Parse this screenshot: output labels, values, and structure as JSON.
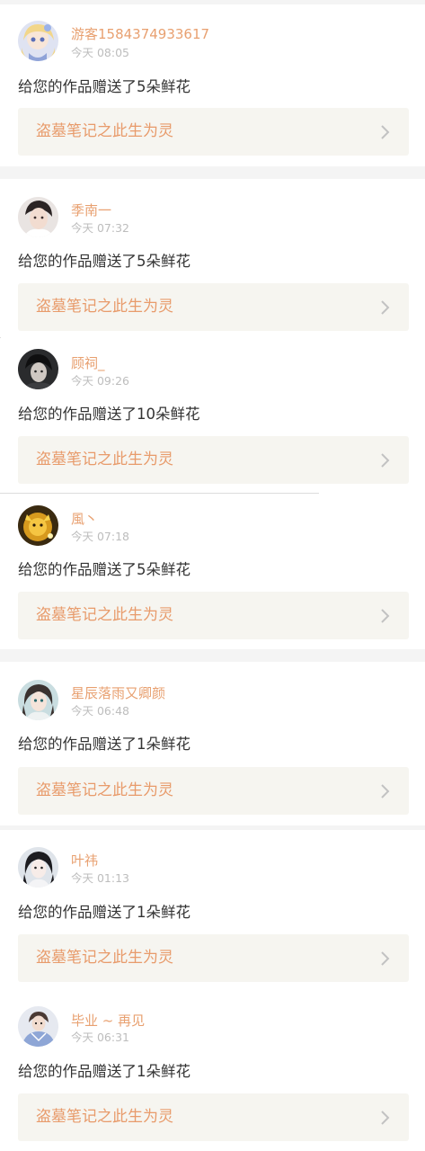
{
  "feed": [
    {
      "username": "游客1584374933617",
      "time": "今天 08:05",
      "message": "给您的作品赠送了5朵鲜花",
      "work_title": "盗墓笔记之此生为灵",
      "avatar": "anime-girl-avatar"
    },
    {
      "username": "季南一",
      "time": "今天 07:32",
      "message": "给您的作品赠送了5朵鲜花",
      "work_title": "盗墓笔记之此生为灵",
      "avatar": "young-man-avatar"
    },
    {
      "username": "顾祠_",
      "time": "今天 09:26",
      "message": "给您的作品赠送了10朵鲜花",
      "work_title": "盗墓笔记之此生为灵",
      "avatar": "dark-portrait-avatar"
    },
    {
      "username": "風丶",
      "time": "今天 07:18",
      "message": "给您的作品赠送了5朵鲜花",
      "work_title": "盗墓笔记之此生为灵",
      "avatar": "golden-creature-avatar"
    },
    {
      "username": "星辰落雨又卿颜",
      "time": "今天 06:48",
      "message": "给您的作品赠送了1朵鲜花",
      "work_title": "盗墓笔记之此生为灵",
      "avatar": "anime-girl-teal-avatar"
    },
    {
      "username": "叶祎",
      "time": "今天 01:13",
      "message": "给您的作品赠送了1朵鲜花",
      "work_title": "盗墓笔记之此生为灵",
      "avatar": "girl-portrait-avatar"
    },
    {
      "username": "毕业 ~ 再见",
      "time": "今天 06:31",
      "message": "给您的作品赠送了1朵鲜花",
      "work_title": "盗墓笔记之此生为灵",
      "avatar": "blue-shirt-avatar"
    }
  ],
  "colors": {
    "username": "#e8a070",
    "work_title": "#e89b6b",
    "time": "#bdbdbd",
    "message": "#333333",
    "link_bg": "#f6f5f0",
    "separator": "#f4f4f4"
  },
  "icons": {
    "chevron": "chevron-right-icon"
  }
}
